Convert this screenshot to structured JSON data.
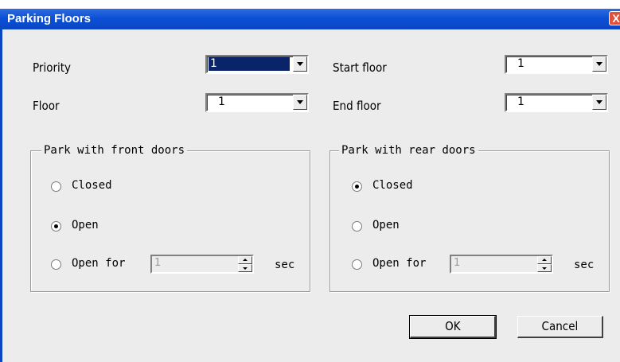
{
  "window": {
    "title": "Parking Floors",
    "close_glyph": "X"
  },
  "fields": {
    "priority": {
      "label": "Priority",
      "value": "1"
    },
    "floor": {
      "label": "Floor",
      "value": "1"
    },
    "start_floor": {
      "label": "Start floor",
      "value": "1"
    },
    "end_floor": {
      "label": "End floor",
      "value": "1"
    }
  },
  "front_doors": {
    "title": "Park with front doors",
    "options": [
      "Closed",
      "Open",
      "Open for"
    ],
    "selected": "Open",
    "open_for_value": "1",
    "unit": "sec"
  },
  "rear_doors": {
    "title": "Park with rear doors",
    "options": [
      "Closed",
      "Open",
      "Open for"
    ],
    "selected": "Closed",
    "open_for_value": "1",
    "unit": "sec"
  },
  "buttons": {
    "ok": "OK",
    "cancel": "Cancel"
  },
  "colors": {
    "titlebar": "#0c50d6",
    "selection": "#0a246a",
    "dialog_bg": "#ececec"
  }
}
